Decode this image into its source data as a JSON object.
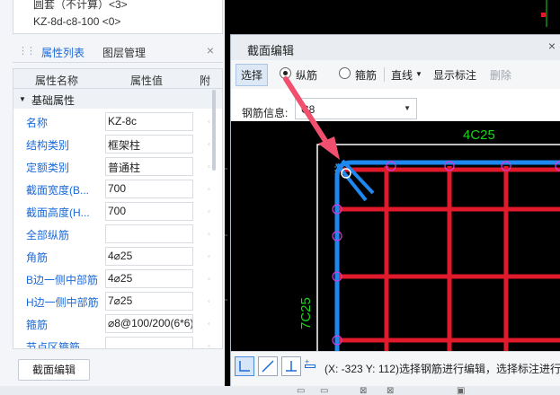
{
  "top_list": {
    "item1": "圆套（不计算）<3>",
    "item2": "KZ-8d-c8-100 <0>"
  },
  "panel": {
    "tab_properties": "属性列表",
    "tab_layers": "图层管理",
    "col_name": "属性名称",
    "col_value": "属性值",
    "col_extra": "附",
    "group": "基础属性",
    "rows": [
      {
        "k": "名称",
        "v": "KZ-8c"
      },
      {
        "k": "结构类别",
        "v": "框架柱"
      },
      {
        "k": "定额类别",
        "v": "普通柱"
      },
      {
        "k": "截面宽度(B...",
        "v": "700"
      },
      {
        "k": "截面高度(H...",
        "v": "700"
      },
      {
        "k": "全部纵筋",
        "v": ""
      },
      {
        "k": "角筋",
        "v": "4⌀25"
      },
      {
        "k": "B边一侧中部筋",
        "v": "4⌀25"
      },
      {
        "k": "H边一侧中部筋",
        "v": "7⌀25"
      },
      {
        "k": "箍筋",
        "v": "⌀8@100/200(6*6)"
      },
      {
        "k": "节点区箍筋",
        "v": ""
      }
    ],
    "section_edit_btn": "截面编辑"
  },
  "dialog": {
    "title": "截面编辑",
    "toolbar": {
      "select": "选择",
      "longitudinal": "纵筋",
      "stirrup": "箍筋",
      "line": "直线",
      "show_label": "显示标注",
      "delete": "删除"
    },
    "rebar_info_label": "钢筋信息:",
    "rebar_info_value": "C8",
    "drawing": {
      "top_label": "4C25",
      "left_label": "7C25"
    },
    "status_message": "(X: -323 Y: 112)选择钢筋进行编辑，选择标注进行"
  },
  "colors": {
    "accent": "#1b6ad8",
    "stirrup_red": "#e0192b",
    "outline_blue": "#1e88f0",
    "label_green": "#19d619",
    "bar_magenta": "#d23cd2",
    "arrow": "#f0506e"
  }
}
